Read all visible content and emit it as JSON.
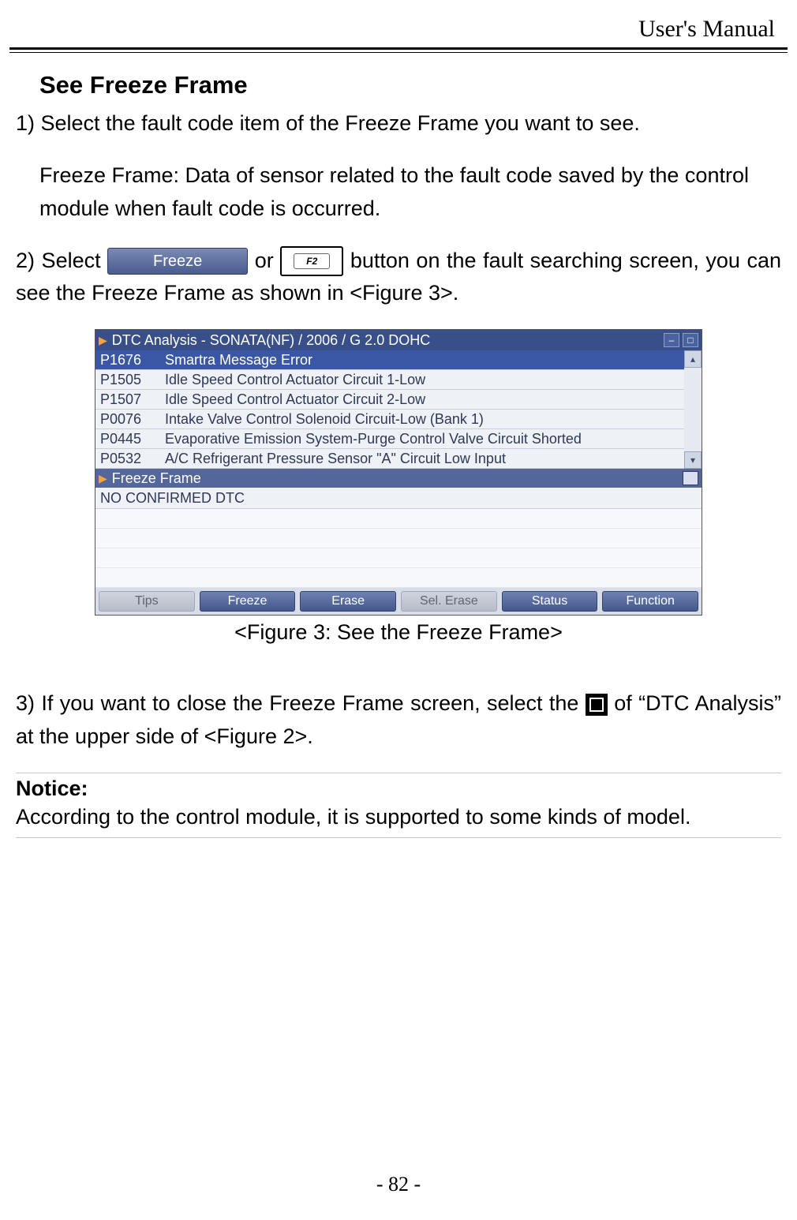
{
  "header": {
    "title": "User's Manual"
  },
  "section": {
    "heading": "See Freeze Frame",
    "step1_num": "1)",
    "step1_text": " Select the fault code item of the Freeze Frame you want to see.",
    "definition": "Freeze Frame: Data of sensor related to the fault code saved by the control module when fault code is occurred.",
    "step2_num": "2)",
    "step2_before": " Select ",
    "freeze_btn_label": "Freeze",
    "step2_mid": " or ",
    "f2_label": "F2",
    "step2_after": " button on the fault searching screen, you can see the Freeze Frame as shown in <Figure 3>.",
    "figure_caption": "<Figure 3: See the Freeze Frame>",
    "step3_num": "3)",
    "step3_before": " If you want to close the Freeze Frame screen, select the ",
    "step3_after1": " of “DTC Analysis” at the upper side of <Figure 2>.",
    "notice_label": "Notice:",
    "notice_text": "According to the control module, it is supported to some kinds of model."
  },
  "screenshot": {
    "title": "DTC Analysis - SONATA(NF) / 2006 / G 2.0 DOHC",
    "rows": [
      {
        "code": "P1676",
        "desc": "Smartra Message Error"
      },
      {
        "code": "P1505",
        "desc": "Idle Speed Control Actuator Circuit 1-Low"
      },
      {
        "code": "P1507",
        "desc": "Idle Speed Control Actuator Circuit 2-Low"
      },
      {
        "code": "P0076",
        "desc": "Intake Valve Control Solenoid Circuit-Low (Bank 1)"
      },
      {
        "code": "P0445",
        "desc": "Evaporative Emission System-Purge Control Valve Circuit Shorted"
      },
      {
        "code": "P0532",
        "desc": "A/C Refrigerant Pressure Sensor \"A\" Circuit Low Input"
      }
    ],
    "sub_title": "Freeze Frame",
    "confirmed": "NO CONFIRMED DTC",
    "footer": {
      "tips": "Tips",
      "freeze": "Freeze",
      "erase": "Erase",
      "sel_erase": "Sel. Erase",
      "status": "Status",
      "function": "Function"
    }
  },
  "page_number": "- 82 -"
}
